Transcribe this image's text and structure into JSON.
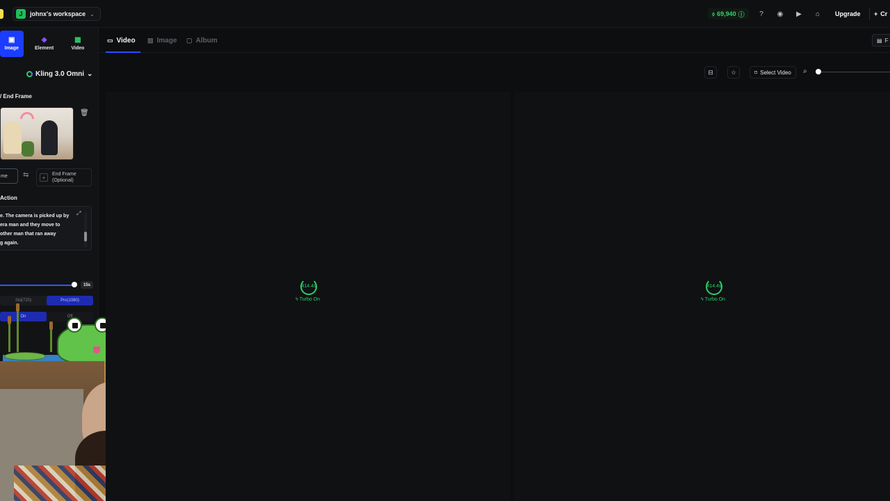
{
  "topbar": {
    "workspace_initial": "J",
    "workspace_name": "johnx's workspace",
    "credits": "69,940",
    "upgrade_label": "Upgrade",
    "create_label": "Cr"
  },
  "modes": [
    {
      "label": "Image",
      "icon": "image-icon",
      "active": true
    },
    {
      "label": "Element",
      "icon": "element-icon",
      "active": false
    },
    {
      "label": "Video",
      "icon": "video-icon",
      "active": false
    }
  ],
  "left": {
    "model": "Kling 3.0 Omni",
    "end_frame_section": "/ End Frame",
    "start_frame_chip": "me",
    "end_frame_label_1": "End Frame",
    "end_frame_label_2": "(Optional)",
    "action_section": "Action",
    "prompt_text": "e. The camera is picked up by\nera man and they move to\nother man that ran away\ng again.",
    "duration_value": "15s",
    "quality_options": [
      "Std(720)",
      "Pro(1080)"
    ],
    "quality_selected": "Pro(1080)",
    "turbo_options": [
      "On",
      "Off"
    ],
    "turbo_selected": "On"
  },
  "main": {
    "tabs": [
      {
        "label": "Video",
        "active": true
      },
      {
        "label": "Image",
        "active": false
      },
      {
        "label": "Album",
        "active": false
      }
    ],
    "right_btn_label": "F",
    "select_video_label": "Select Video",
    "generations": [
      {
        "progress_text": "414.4s",
        "turbo_text": "Turbo On"
      },
      {
        "progress_text": "414.4s",
        "turbo_text": "Turbo On"
      }
    ]
  },
  "colors": {
    "accent_blue": "#1b3dff",
    "success_green": "#2ad06a",
    "background": "#0d0e10"
  }
}
